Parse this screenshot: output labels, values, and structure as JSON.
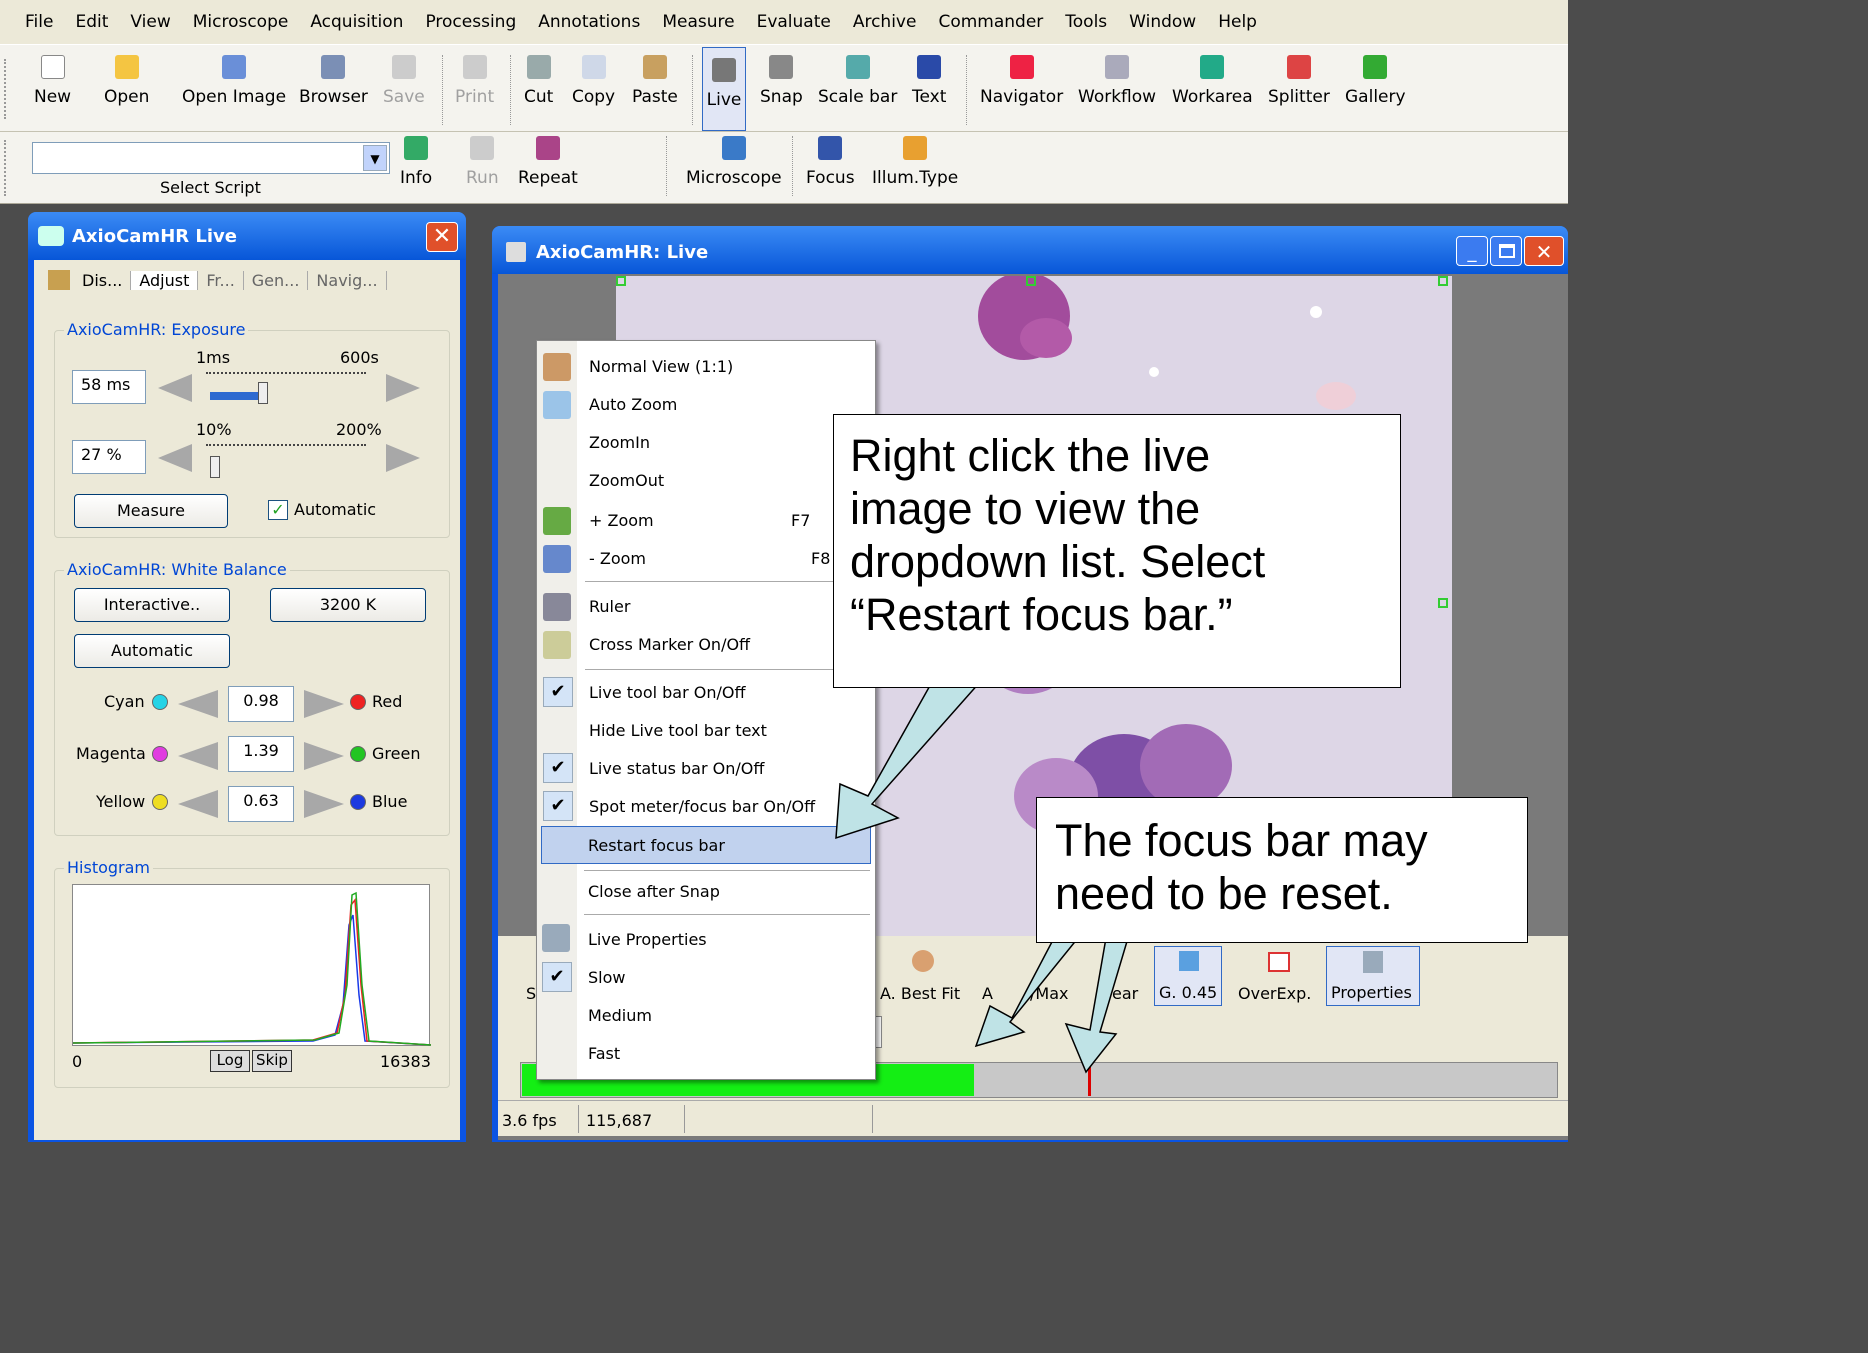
{
  "menubar": [
    "File",
    "Edit",
    "View",
    "Microscope",
    "Acquisition",
    "Processing",
    "Annotations",
    "Measure",
    "Evaluate",
    "Archive",
    "Commander",
    "Tools",
    "Window",
    "Help"
  ],
  "toolbar1": {
    "new": "New",
    "open": "Open",
    "open_image": "Open Image",
    "browser": "Browser",
    "save": "Save",
    "print": "Print",
    "cut": "Cut",
    "copy": "Copy",
    "paste": "Paste",
    "live": "Live",
    "snap": "Snap",
    "scale_bar": "Scale bar",
    "text": "Text",
    "navigator": "Navigator",
    "workflow": "Workflow",
    "workarea": "Workarea",
    "splitter": "Splitter",
    "gallery": "Gallery"
  },
  "toolbar2": {
    "select_script": "Select Script",
    "info": "Info",
    "run": "Run",
    "repeat": "Repeat",
    "microscope": "Microscope",
    "focus": "Focus",
    "illum": "Illum.Type"
  },
  "left_panel": {
    "title": "AxioCamHR Live",
    "tabs": [
      "Dis...",
      "Adjust",
      "Fr...",
      "Gen...",
      "Navig..."
    ],
    "exposure": {
      "group": "AxioCamHR: Exposure",
      "min1": "1ms",
      "max1": "600s",
      "value1": "58 ms",
      "min2": "10%",
      "max2": "200%",
      "value2": "27 %",
      "measure": "Measure",
      "automatic": "Automatic"
    },
    "white_balance": {
      "group": "AxioCamHR: White Balance",
      "interactive": "Interactive..",
      "kelvin": "3200 K",
      "automatic": "Automatic",
      "rows": [
        {
          "left": "Cyan",
          "value": "0.98",
          "right": "Red"
        },
        {
          "left": "Magenta",
          "value": "1.39",
          "right": "Green"
        },
        {
          "left": "Yellow",
          "value": "0.63",
          "right": "Blue"
        }
      ]
    },
    "histogram": {
      "group": "Histogram",
      "min": "0",
      "max": "16383",
      "log": "Log",
      "skip": "Skip"
    }
  },
  "live_window": {
    "title": "AxioCamHR: Live",
    "toolbar": {
      "s": "S",
      "best_fit": "A. Best Fit",
      "a": "A",
      "max": "/Max",
      "ear": "ear",
      "gamma": "G. 0.45",
      "overexp": "OverExp.",
      "properties": "Properties"
    },
    "status": {
      "fps": "3.6 fps",
      "count": "115,687"
    },
    "focus_fraction": 0.44
  },
  "context_menu": {
    "items": [
      "Normal View (1:1)",
      "Auto Zoom",
      "ZoomIn",
      "ZoomOut",
      "+ Zoom",
      "- Zoom",
      "Ruler",
      "Cross Marker On/Off",
      "Live tool bar On/Off",
      "Hide Live tool bar text",
      "Live status bar On/Off",
      "Spot meter/focus bar On/Off",
      "Restart focus bar",
      "Close after Snap",
      "Live Properties",
      "Slow",
      "Medium",
      "Fast"
    ],
    "shortcut_plus": "F7",
    "shortcut_minus": "F8"
  },
  "callouts": {
    "top": [
      "Right click the live",
      "image to view the",
      "dropdown list.  Select",
      "“Restart focus bar.”"
    ],
    "bottom": [
      "The focus bar may",
      "need to be reset."
    ]
  },
  "colors": {
    "xp_blue": "#0a54e3",
    "focus_green": "#14ee14",
    "arrow_fill": "#bfe3e6"
  }
}
